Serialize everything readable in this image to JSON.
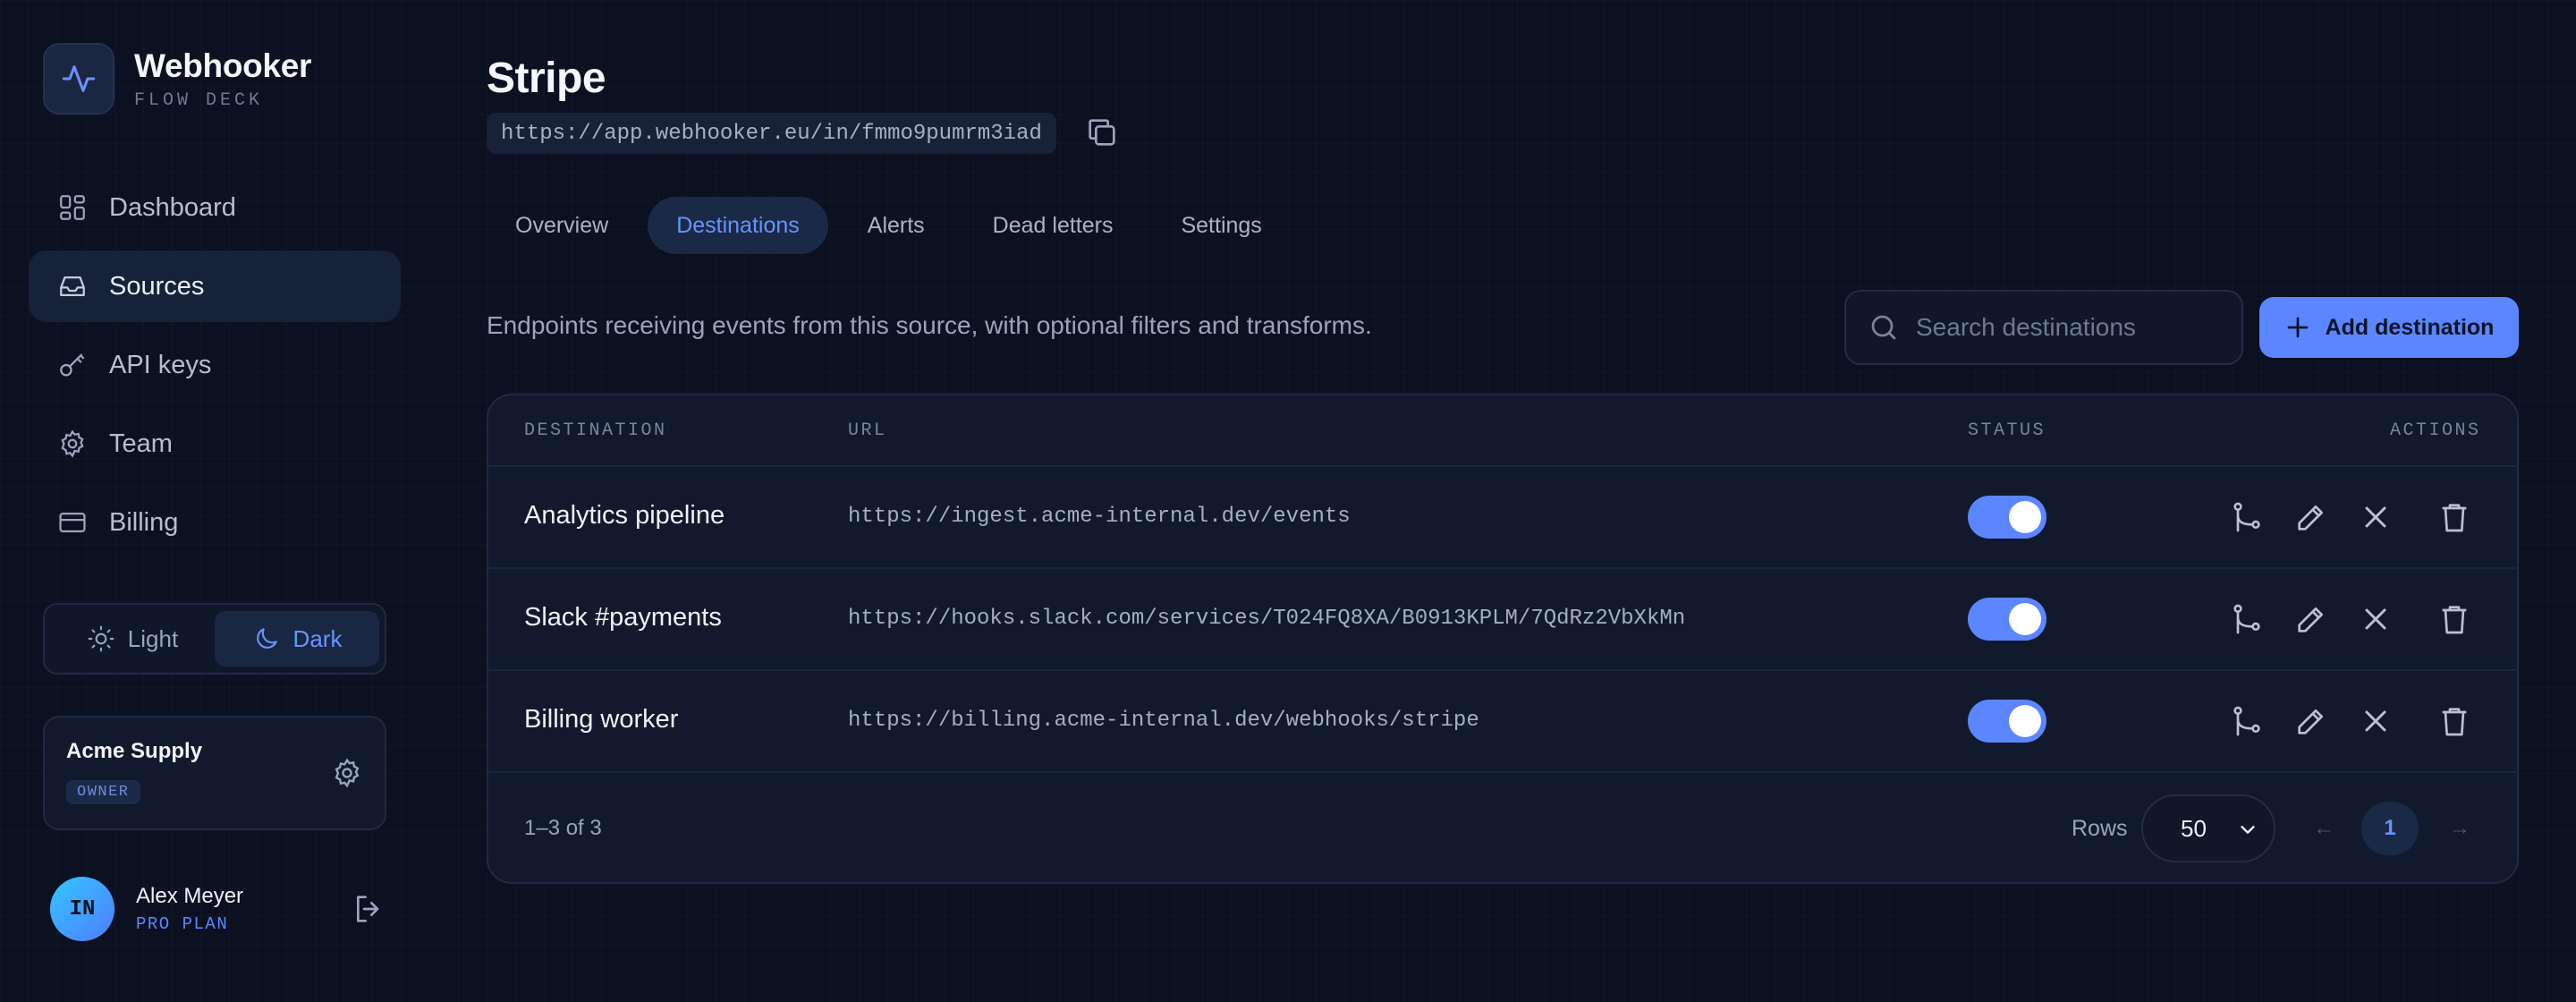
{
  "app": {
    "name": "Webhooker",
    "subtitle": "FLOW DECK"
  },
  "sidebar": {
    "items": [
      {
        "label": "Dashboard",
        "icon": "dashboard-icon",
        "active": false
      },
      {
        "label": "Sources",
        "icon": "inbox-icon",
        "active": true
      },
      {
        "label": "API keys",
        "icon": "key-icon",
        "active": false
      },
      {
        "label": "Team",
        "icon": "gear-icon",
        "active": false
      },
      {
        "label": "Billing",
        "icon": "credit-card-icon",
        "active": false
      }
    ],
    "theme": {
      "light_label": "Light",
      "dark_label": "Dark",
      "selected": "Dark"
    },
    "org": {
      "name": "Acme Supply",
      "role": "OWNER"
    },
    "user": {
      "initials": "IN",
      "name": "Alex Meyer",
      "plan": "PRO PLAN"
    }
  },
  "page": {
    "title": "Stripe",
    "endpoint": "https://app.webhooker.eu/in/fmmo9pumrm3iad",
    "tabs": [
      {
        "label": "Overview",
        "active": false
      },
      {
        "label": "Destinations",
        "active": true
      },
      {
        "label": "Alerts",
        "active": false
      },
      {
        "label": "Dead letters",
        "active": false
      },
      {
        "label": "Settings",
        "active": false
      }
    ],
    "description": "Endpoints receiving events from this source, with optional filters and transforms.",
    "search_placeholder": "Search destinations",
    "add_label": "Add destination"
  },
  "table": {
    "columns": {
      "destination": "DESTINATION",
      "url": "URL",
      "status": "STATUS",
      "actions": "ACTIONS"
    },
    "rows": [
      {
        "name": "Analytics pipeline",
        "url": "https://ingest.acme-internal.dev/events",
        "enabled": true
      },
      {
        "name": "Slack #payments",
        "url": "https://hooks.slack.com/services/T024FQ8XA/B0913KPLM/7QdRz2VbXkMn",
        "enabled": true
      },
      {
        "name": "Billing worker",
        "url": "https://billing.acme-internal.dev/webhooks/stripe",
        "enabled": true
      }
    ],
    "footer": {
      "count": "1–3 of 3",
      "rows_label": "Rows",
      "rows_value": "50",
      "prev": "←",
      "page": "1",
      "next": "→"
    }
  },
  "colors": {
    "accent": "#5b86ff",
    "background": "#0b1120",
    "card": "#111a2c"
  }
}
